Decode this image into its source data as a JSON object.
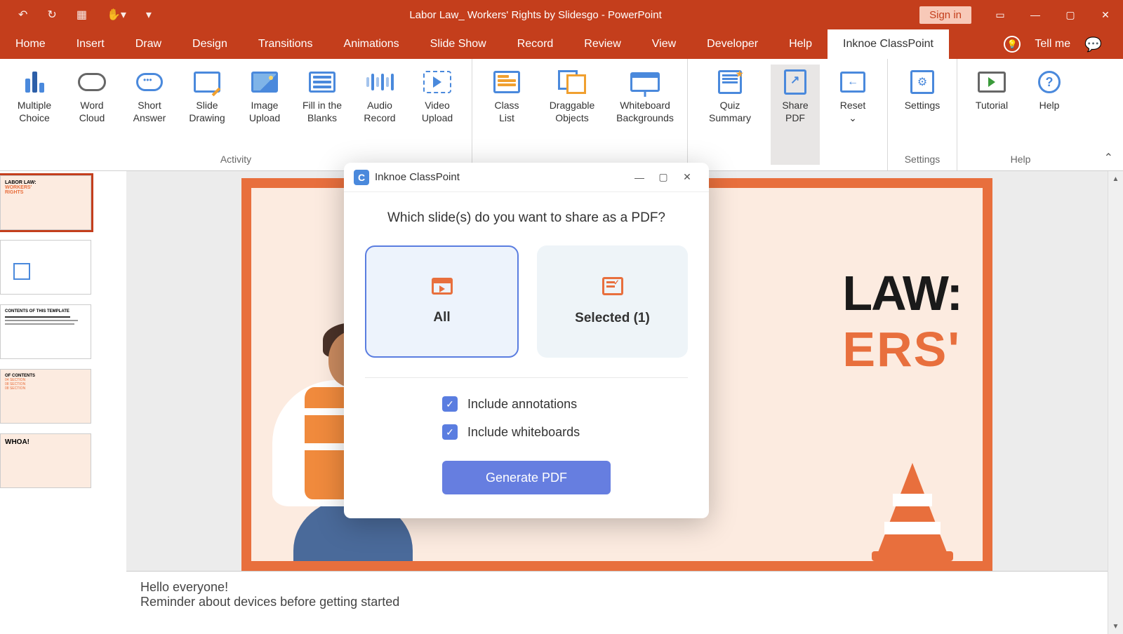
{
  "titlebar": {
    "title": "Labor Law_ Workers' Rights by Slidesgo  -  PowerPoint",
    "signin": "Sign in"
  },
  "tabs": {
    "items": [
      "Home",
      "Insert",
      "Draw",
      "Design",
      "Transitions",
      "Animations",
      "Slide Show",
      "Record",
      "Review",
      "View",
      "Developer",
      "Help",
      "Inknoe ClassPoint"
    ],
    "active": 12,
    "tellme": "Tell me"
  },
  "ribbon": {
    "groups": [
      {
        "label": "Activity",
        "items": [
          {
            "l1": "Multiple",
            "l2": "Choice",
            "icon": "mc"
          },
          {
            "l1": "Word",
            "l2": "Cloud",
            "icon": "cloud"
          },
          {
            "l1": "Short",
            "l2": "Answer",
            "icon": "bubble"
          },
          {
            "l1": "Slide",
            "l2": "Drawing",
            "icon": "draw"
          },
          {
            "l1": "Image",
            "l2": "Upload",
            "icon": "img"
          },
          {
            "l1": "Fill in the",
            "l2": "Blanks",
            "icon": "form"
          },
          {
            "l1": "Audio",
            "l2": "Record",
            "icon": "audio"
          },
          {
            "l1": "Video",
            "l2": "Upload",
            "icon": "vid"
          }
        ]
      },
      {
        "label": "",
        "items": [
          {
            "l1": "Class",
            "l2": "List",
            "icon": "list"
          },
          {
            "l1": "Draggable",
            "l2": "Objects",
            "icon": "drag",
            "wide": true
          },
          {
            "l1": "Whiteboard",
            "l2": "Backgrounds",
            "icon": "board",
            "wide": true
          }
        ]
      },
      {
        "label": "",
        "items": [
          {
            "l1": "Quiz",
            "l2": "Summary",
            "icon": "quiz",
            "wide": true
          },
          {
            "l1": "Share",
            "l2": "PDF",
            "icon": "pdf",
            "active": true
          },
          {
            "l1": "Reset",
            "l2": "⌄",
            "icon": "reset"
          }
        ]
      },
      {
        "label": "Settings",
        "items": [
          {
            "l1": "Settings",
            "l2": "",
            "icon": "gear"
          }
        ]
      },
      {
        "label": "Help",
        "items": [
          {
            "l1": "Tutorial",
            "l2": "",
            "icon": "tut"
          },
          {
            "l1": "Help",
            "l2": "",
            "icon": "help"
          }
        ]
      }
    ]
  },
  "slide": {
    "title_l1": "LAW:",
    "title_l2": "ERS'"
  },
  "thumbs": {
    "t1_l1": "LABOR LAW:",
    "t1_l2": "WORKERS'",
    "t1_l3": "RIGHTS",
    "t3": "CONTENTS OF THIS TEMPLATE",
    "t4": "OF CONTENTS",
    "t4a": "04 SECTION",
    "t4b": "08 SECTION",
    "t4c": "08 SECTION",
    "t5": "WHOA!"
  },
  "notes": {
    "l1": "Hello everyone!",
    "l2": "Reminder about devices before getting started"
  },
  "dialog": {
    "title": "Inknoe ClassPoint",
    "question": "Which slide(s) do you want to share as a PDF?",
    "opt_all": "All",
    "opt_sel": "Selected (1)",
    "chk1": "Include annotations",
    "chk2": "Include whiteboards",
    "btn": "Generate PDF"
  }
}
